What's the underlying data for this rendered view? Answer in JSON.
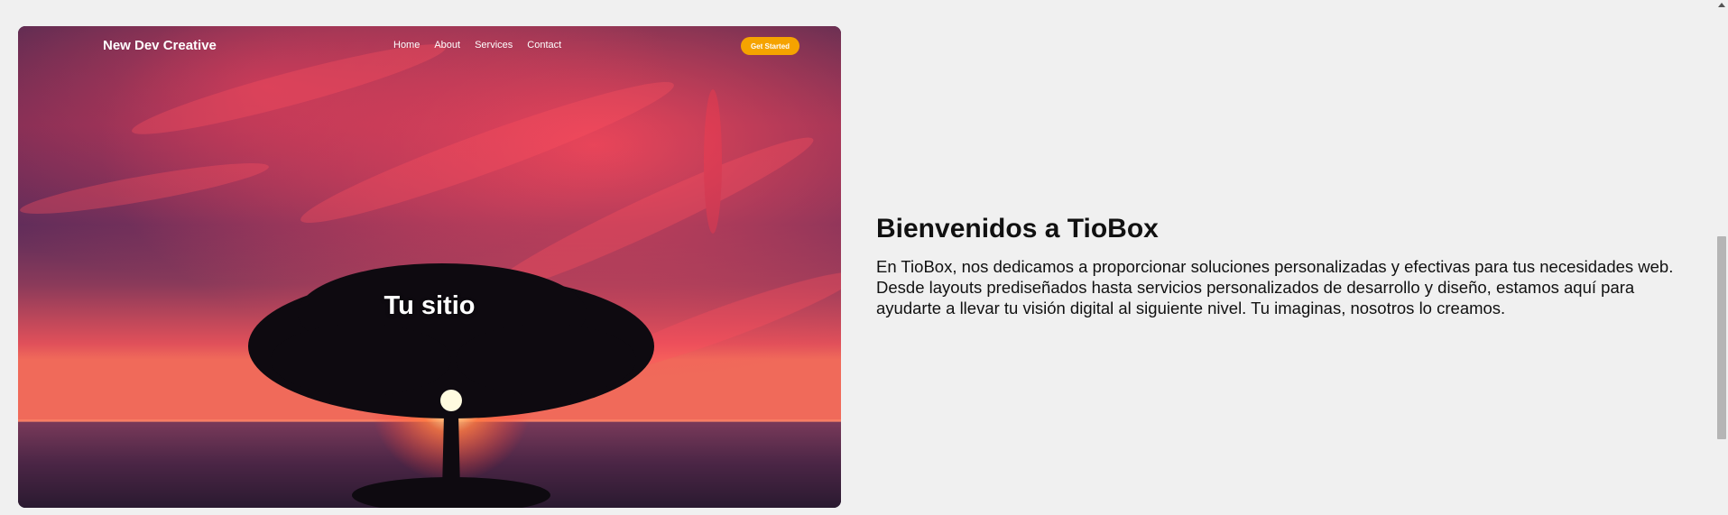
{
  "header": {
    "brand": "New Dev Creative",
    "nav": [
      "Home",
      "About",
      "Services",
      "Contact"
    ],
    "cta_label": "Get Started"
  },
  "hero": {
    "title": "Tu sitio"
  },
  "welcome": {
    "title": "Bienvenidos a TioBox",
    "text": "En TioBox, nos dedicamos a proporcionar soluciones personalizadas y efectivas para tus necesidades web. Desde layouts prediseñados hasta servicios personalizados de desarrollo y diseño, estamos aquí para ayudarte a llevar tu visión digital al siguiente nivel. Tu imaginas, nosotros lo creamos."
  },
  "colors": {
    "page_background": "#f0f0f0",
    "cta_background": "#f5a300",
    "sky_top": "#2a1f4a",
    "sky_red": "#e23a4a",
    "sea": "#3a1f3a"
  }
}
